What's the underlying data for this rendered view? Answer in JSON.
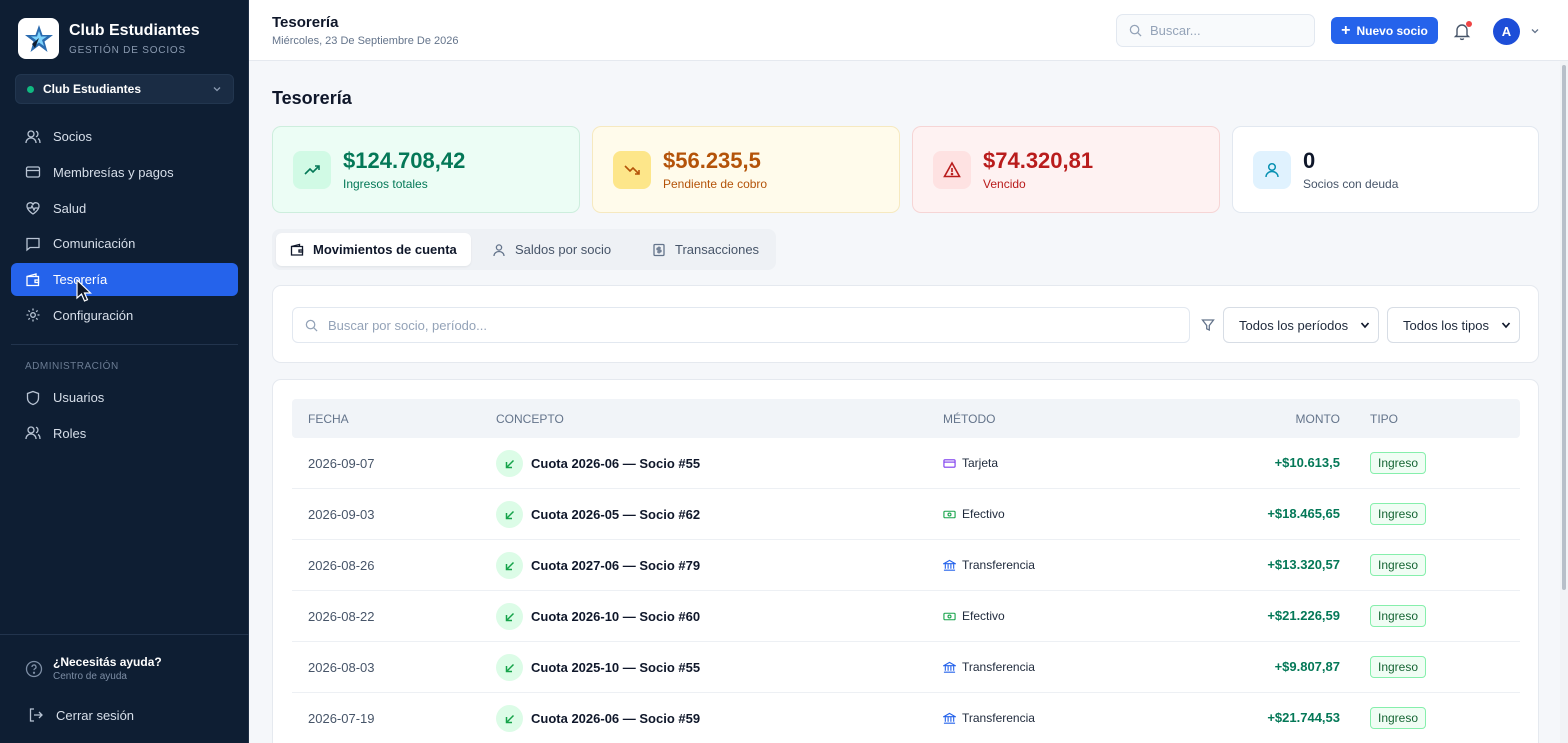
{
  "sidebar": {
    "brand_name": "Club Estudiantes",
    "brand_sub": "GESTIÓN DE SOCIOS",
    "club_selected": "Club Estudiantes",
    "items": [
      {
        "label": "Socios",
        "icon": "users-icon"
      },
      {
        "label": "Membresías y pagos",
        "icon": "credit-card-icon"
      },
      {
        "label": "Salud",
        "icon": "heart-pulse-icon"
      },
      {
        "label": "Comunicación",
        "icon": "message-icon"
      },
      {
        "label": "Tesorería",
        "icon": "wallet-icon",
        "active": true
      },
      {
        "label": "Configuración",
        "icon": "gear-icon"
      }
    ],
    "admin_label": "ADMINISTRACIÓN",
    "admin_items": [
      {
        "label": "Usuarios",
        "icon": "shield-icon"
      },
      {
        "label": "Roles",
        "icon": "users-icon"
      }
    ],
    "help_title": "¿Necesitás ayuda?",
    "help_sub": "Centro de ayuda",
    "logout": "Cerrar sesión"
  },
  "header": {
    "title": "Tesorería",
    "date": "Miércoles, 23 De Septiembre De 2026",
    "search_placeholder": "Buscar...",
    "new_button": "Nuevo socio",
    "avatar_initial": "A"
  },
  "main": {
    "page_title": "Tesorería",
    "stats": [
      {
        "value": "$124.708,42",
        "label": "Ingresos totales",
        "icon": "trending-up-icon",
        "color": "#047857"
      },
      {
        "value": "$56.235,5",
        "label": "Pendiente de cobro",
        "icon": "trending-down-icon",
        "color": "#b45309"
      },
      {
        "value": "$74.320,81",
        "label": "Vencido",
        "icon": "alert-triangle-icon",
        "color": "#b91c1c"
      },
      {
        "value": "0",
        "label": "Socios con deuda",
        "icon": "user-icon",
        "color": "#0f172a"
      }
    ],
    "tabs": [
      {
        "label": "Movimientos de cuenta",
        "icon": "wallet-icon",
        "active": true
      },
      {
        "label": "Saldos por socio",
        "icon": "user-icon"
      },
      {
        "label": "Transacciones",
        "icon": "receipt-icon"
      }
    ],
    "filter": {
      "search_placeholder": "Buscar por socio, período...",
      "period_select": "Todos los períodos",
      "type_select": "Todos los tipos"
    },
    "table": {
      "columns": [
        "FECHA",
        "CONCEPTO",
        "MÉTODO",
        "MONTO",
        "TIPO"
      ],
      "rows": [
        {
          "date": "2026-09-07",
          "concept": "Cuota 2026-06 — Socio #55",
          "method": "Tarjeta",
          "method_icon": "card-icon",
          "amount": "+$10.613,5",
          "type": "Ingreso"
        },
        {
          "date": "2026-09-03",
          "concept": "Cuota 2026-05 — Socio #62",
          "method": "Efectivo",
          "method_icon": "cash-icon",
          "amount": "+$18.465,65",
          "type": "Ingreso"
        },
        {
          "date": "2026-08-26",
          "concept": "Cuota 2027-06 — Socio #79",
          "method": "Transferencia",
          "method_icon": "bank-icon",
          "amount": "+$13.320,57",
          "type": "Ingreso"
        },
        {
          "date": "2026-08-22",
          "concept": "Cuota 2026-10 — Socio #60",
          "method": "Efectivo",
          "method_icon": "cash-icon",
          "amount": "+$21.226,59",
          "type": "Ingreso"
        },
        {
          "date": "2026-08-03",
          "concept": "Cuota 2025-10 — Socio #55",
          "method": "Transferencia",
          "method_icon": "bank-icon",
          "amount": "+$9.807,87",
          "type": "Ingreso"
        },
        {
          "date": "2026-07-19",
          "concept": "Cuota 2026-06 — Socio #59",
          "method": "Transferencia",
          "method_icon": "bank-icon",
          "amount": "+$21.744,53",
          "type": "Ingreso"
        }
      ]
    }
  },
  "colors": {
    "sidebar_bg": "#0e1e33",
    "accent": "#2563eb",
    "income_green": "#047857"
  }
}
